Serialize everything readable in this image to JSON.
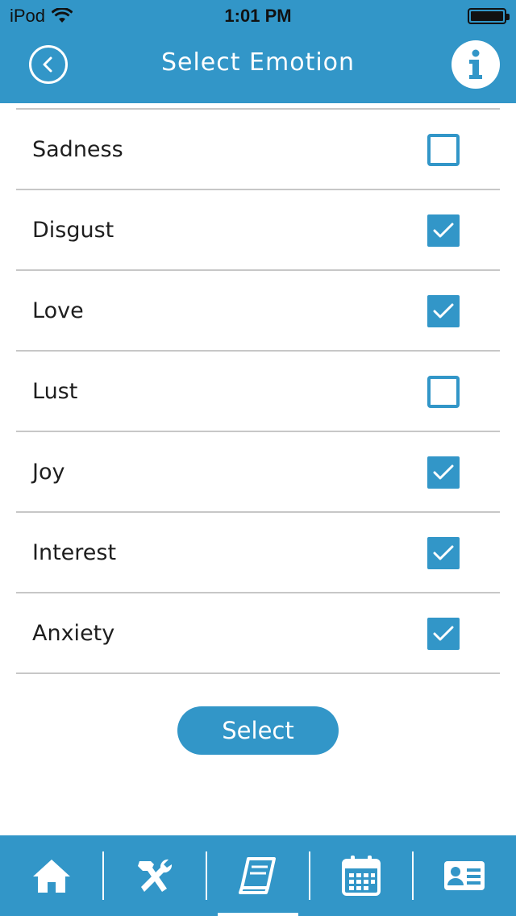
{
  "status_bar": {
    "carrier": "iPod",
    "time": "1:01 PM"
  },
  "header": {
    "title": "Select Emotion",
    "back_icon": "chevron-left-circle-icon",
    "info_icon": "info-icon"
  },
  "emotions": [
    {
      "label": "Sadness",
      "checked": false
    },
    {
      "label": "Disgust",
      "checked": true
    },
    {
      "label": "Love",
      "checked": true
    },
    {
      "label": "Lust",
      "checked": false
    },
    {
      "label": "Joy",
      "checked": true
    },
    {
      "label": "Interest",
      "checked": true
    },
    {
      "label": "Anxiety",
      "checked": true
    }
  ],
  "select_button": {
    "label": "Select"
  },
  "tabbar": {
    "items": [
      {
        "icon": "home-icon",
        "active": false
      },
      {
        "icon": "tools-icon",
        "active": false
      },
      {
        "icon": "book-icon",
        "active": true
      },
      {
        "icon": "calendar-icon",
        "active": false
      },
      {
        "icon": "contact-card-icon",
        "active": false
      }
    ]
  },
  "colors": {
    "accent": "#3296c8"
  }
}
